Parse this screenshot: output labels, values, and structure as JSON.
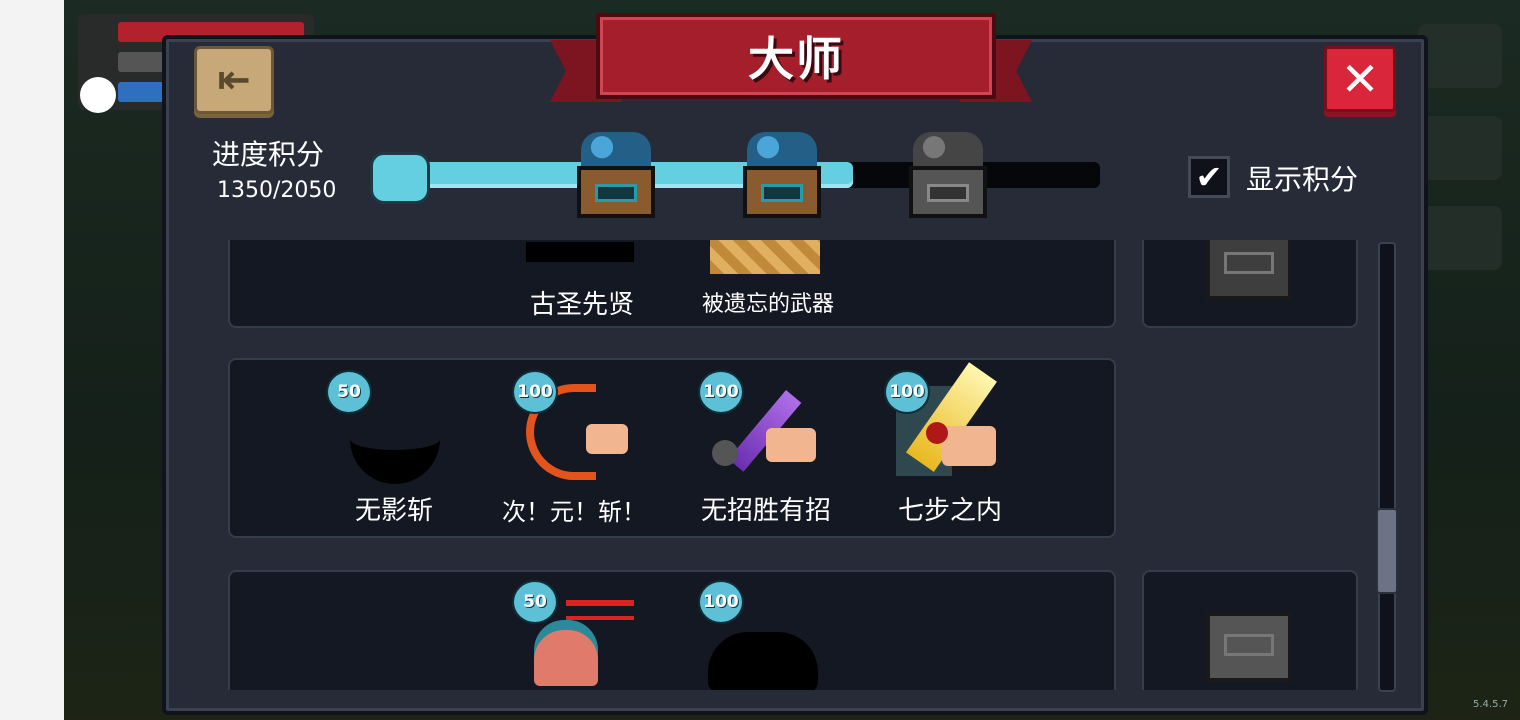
{
  "title": "大师",
  "progress": {
    "label": "进度积分",
    "value_text": "1350/2050",
    "current": 1350,
    "max": 2050,
    "fill_fraction": 0.66
  },
  "show_points": {
    "label": "显示积分",
    "checked": true,
    "check_glyph": "✔"
  },
  "buttons": {
    "close_glyph": "✕",
    "back_glyph": "⇤"
  },
  "rows": [
    {
      "items": [
        {
          "name": "古圣先贤",
          "points": null
        },
        {
          "name": "被遗忘的武器",
          "points": null
        }
      ]
    },
    {
      "items": [
        {
          "name": "无影斩",
          "points": "50"
        },
        {
          "name": "次！元！斩！",
          "points": "100"
        },
        {
          "name": "无招胜有招",
          "points": "100"
        },
        {
          "name": "七步之内",
          "points": "100"
        }
      ]
    },
    {
      "items": [
        {
          "name": "",
          "points": "50"
        },
        {
          "name": "",
          "points": "100"
        }
      ]
    }
  ],
  "hud": {
    "version": "5.4.5.7"
  },
  "colors": {
    "panel": "#262b37",
    "card": "#141823",
    "progress_fill": "#63cfe0",
    "ribbon": "#a51e2b",
    "close": "#d9263a",
    "badge": "#5ec0d6"
  },
  "icons": [
    "back-arrow-icon",
    "close-x-icon",
    "check-icon",
    "blue-gem-chest-icon",
    "grey-gem-chest-icon",
    "reward-chest-icon"
  ]
}
